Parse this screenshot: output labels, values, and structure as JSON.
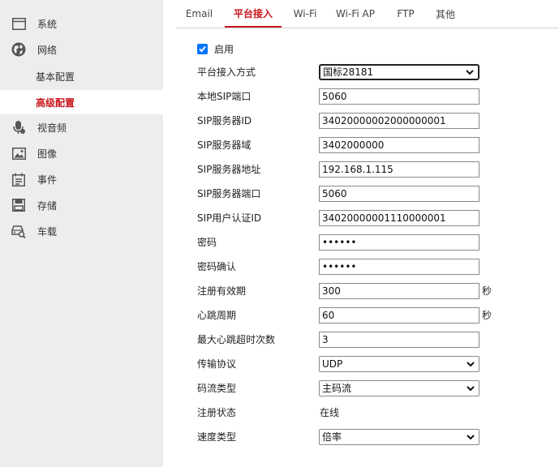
{
  "sidebar": {
    "items": [
      {
        "label": "系统",
        "icon": "window-icon"
      },
      {
        "label": "网络",
        "icon": "globe-icon"
      },
      {
        "label": "视音频",
        "icon": "microphone-icon"
      },
      {
        "label": "图像",
        "icon": "image-icon"
      },
      {
        "label": "事件",
        "icon": "calendar-icon"
      },
      {
        "label": "存储",
        "icon": "disk-icon"
      },
      {
        "label": "车载",
        "icon": "vehicle-search-icon"
      }
    ],
    "subitems": [
      {
        "label": "基本配置"
      },
      {
        "label": "高级配置",
        "active": true
      }
    ]
  },
  "tabs": [
    "Email",
    "平台接入",
    "Wi-Fi",
    "Wi-Fi AP",
    "FTP",
    "其他"
  ],
  "active_tab": "平台接入",
  "accent_color": "#c8171d",
  "form": {
    "enable_label": "启用",
    "enabled": true,
    "access_mode": {
      "label": "平台接入方式",
      "value": "国标28181"
    },
    "local_sip_port": {
      "label": "本地SIP端口",
      "value": "5060"
    },
    "sip_server_id": {
      "label": "SIP服务器ID",
      "value": "34020000002000000001"
    },
    "sip_server_domain": {
      "label": "SIP服务器域",
      "value": "3402000000"
    },
    "sip_server_address": {
      "label": "SIP服务器地址",
      "value": "192.168.1.115"
    },
    "sip_server_port": {
      "label": "SIP服务器端口",
      "value": "5060"
    },
    "sip_user_auth_id": {
      "label": "SIP用户认证ID",
      "value": "34020000001110000001"
    },
    "password": {
      "label": "密码",
      "value": "123456"
    },
    "password_confirm": {
      "label": "密码确认",
      "value": "123456"
    },
    "register_validity": {
      "label": "注册有效期",
      "value": "300",
      "unit": "秒"
    },
    "heartbeat_period": {
      "label": "心跳周期",
      "value": "60",
      "unit": "秒"
    },
    "max_heartbeat_timeouts": {
      "label": "最大心跳超时次数",
      "value": "3"
    },
    "transport_protocol": {
      "label": "传输协议",
      "value": "UDP"
    },
    "stream_type": {
      "label": "码流类型",
      "value": "主码流"
    },
    "register_status": {
      "label": "注册状态",
      "value": "在线"
    },
    "speed_type": {
      "label": "速度类型",
      "value": "倍率"
    }
  }
}
